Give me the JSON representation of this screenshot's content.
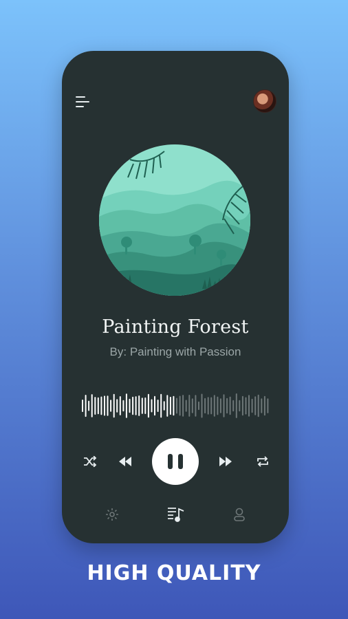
{
  "player": {
    "title": "Painting Forest",
    "artist": "By: Painting with Passion",
    "progress": 0.5
  },
  "header": {
    "menu_icon": "menu-icon",
    "avatar": "user-avatar"
  },
  "controls": {
    "shuffle_icon": "shuffle-icon",
    "previous_icon": "rewind-icon",
    "play_pause_icon": "pause-icon",
    "next_icon": "fast-forward-icon",
    "repeat_icon": "repeat-icon"
  },
  "bottom_nav": {
    "items": [
      "settings-icon",
      "playlist-icon",
      "profile-icon"
    ],
    "active": "playlist-icon"
  },
  "footer": {
    "tagline": "HIGH QUALITY"
  },
  "colors": {
    "phone_bg": "#263132",
    "accent": "#5fbfa6",
    "wave_played": "#ffffff",
    "wave_remaining": "#6e7778"
  }
}
